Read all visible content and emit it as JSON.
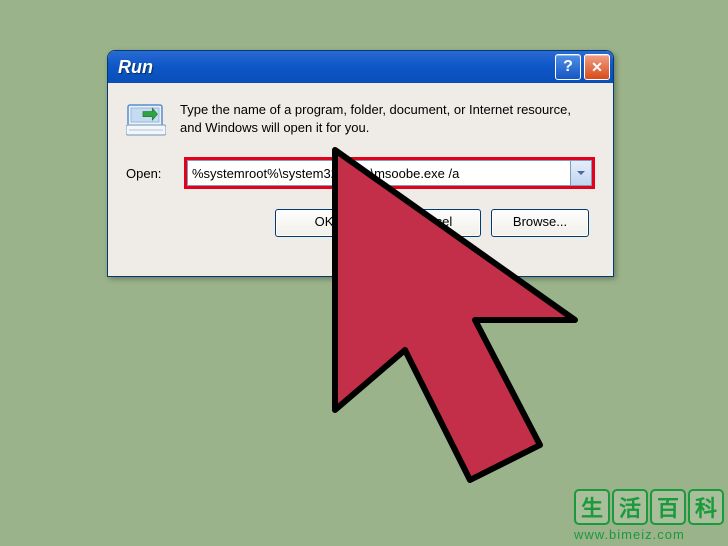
{
  "window": {
    "title": "Run",
    "help_glyph": "?",
    "close_glyph": "✕"
  },
  "body": {
    "description": "Type the name of a program, folder, document, or Internet resource, and Windows will open it for you.",
    "open_label": "Open:",
    "open_value": "%systemroot%\\system32\\oobe\\msoobe.exe /a"
  },
  "buttons": {
    "ok": "OK",
    "cancel": "Cancel",
    "browse": "Browse..."
  },
  "watermark": {
    "c1": "生",
    "c2": "活",
    "c3": "百",
    "c4": "科",
    "url": "www.bimeiz.com"
  }
}
